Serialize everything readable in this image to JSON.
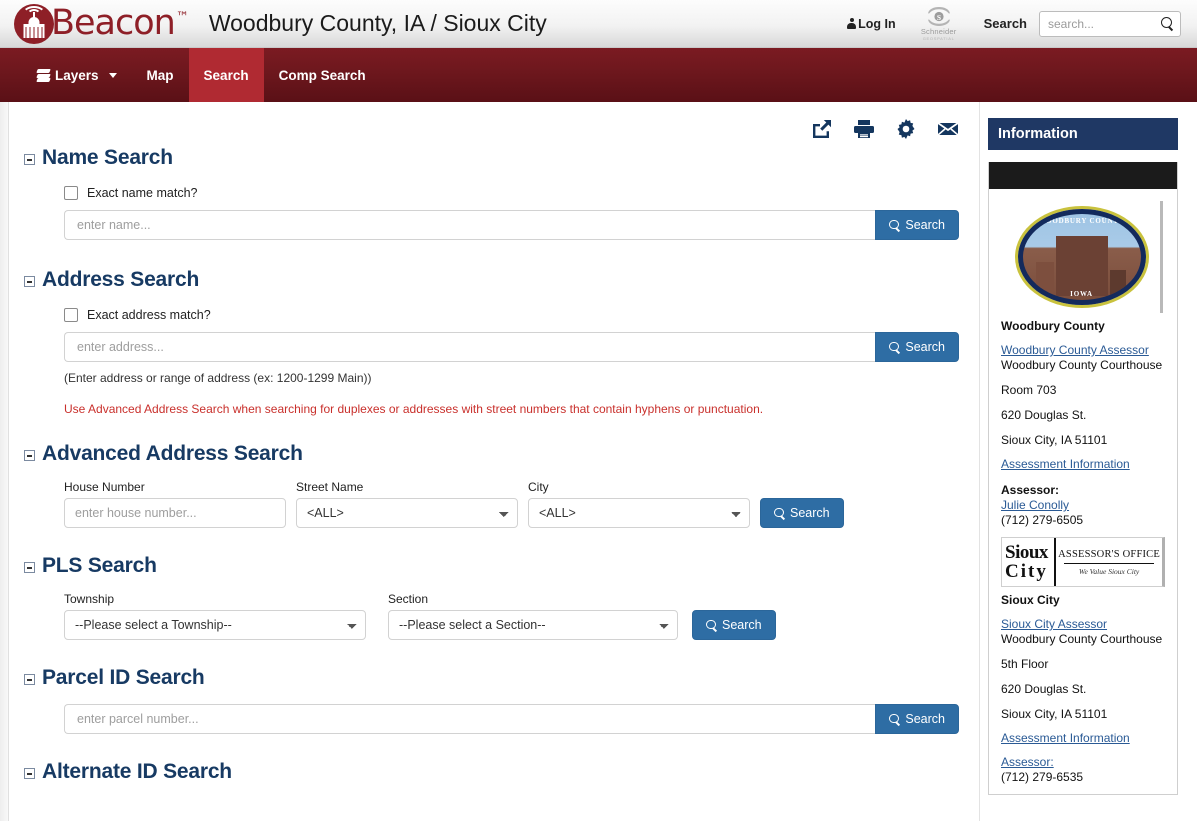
{
  "header": {
    "brand_name": "Beacon",
    "brand_tm": "™",
    "site_title": "Woodbury County, IA / Sioux City",
    "login_label": "Log In",
    "schneider_word": "Schneider",
    "schneider_sub": "GEOSPATIAL",
    "search_word": "Search",
    "search_placeholder": "search...",
    "search_value": ""
  },
  "nav": {
    "layers_label": "Layers",
    "items": [
      {
        "label": "Map",
        "active": false
      },
      {
        "label": "Search",
        "active": true
      },
      {
        "label": "Comp Search",
        "active": false
      }
    ]
  },
  "toolbar": {
    "share_title": "Share",
    "print_title": "Print",
    "settings_title": "Settings",
    "email_title": "Email"
  },
  "sections": {
    "name_search": {
      "title": "Name Search",
      "checkbox_label": "Exact name match?",
      "input_placeholder": "enter name...",
      "input_value": "",
      "button_label": "Search"
    },
    "address_search": {
      "title": "Address Search",
      "checkbox_label": "Exact address match?",
      "input_placeholder": "enter address...",
      "input_value": "",
      "button_label": "Search",
      "hint": "(Enter address or range of address (ex: 1200-1299 Main))",
      "warning": "Use Advanced Address Search when searching for duplexes or addresses with street numbers that contain hyphens or punctuation."
    },
    "advanced_address_search": {
      "title": "Advanced Address Search",
      "house_number_label": "House Number",
      "house_number_placeholder": "enter house number...",
      "house_number_value": "",
      "street_name_label": "Street Name",
      "street_name_value": "<ALL>",
      "city_label": "City",
      "city_value": "<ALL>",
      "button_label": "Search"
    },
    "pls_search": {
      "title": "PLS Search",
      "township_label": "Township",
      "township_value": "--Please select a Township--",
      "section_label": "Section",
      "section_value": "--Please select a Section--",
      "button_label": "Search"
    },
    "parcel_id_search": {
      "title": "Parcel ID Search",
      "input_placeholder": "enter parcel number...",
      "input_value": "",
      "button_label": "Search"
    },
    "alternate_id_search": {
      "title": "Alternate ID Search"
    }
  },
  "sidebar": {
    "panel_title": "Information",
    "county_seal_top": "WOODBURY COUNTY",
    "county_seal_bottom": "IOWA",
    "county_name": "Woodbury County",
    "county_assessor_link": "Woodbury County Assessor",
    "county_courthouse": "Woodbury County Courthouse",
    "county_room": "Room 703",
    "county_street": "620 Douglas St.",
    "county_citystatezip": "Sioux City, IA 51101",
    "county_assessment_link": "Assessment Information",
    "county_assessor_label": "Assessor:",
    "county_assessor_name": "Julie Conolly",
    "county_phone": "(712) 279-6505",
    "sc_logo_city": "Sioux",
    "sc_logo_city2": "City",
    "sc_logo_office": "ASSESSOR'S OFFICE",
    "sc_logo_tagline": "We Value Sioux City",
    "sc_name": "Sioux City",
    "sc_assessor_link": "Sioux City Assessor",
    "sc_courthouse": "Woodbury County Courthouse",
    "sc_floor": "5th Floor",
    "sc_street": "620 Douglas St.",
    "sc_citystatezip": "Sioux City, IA 51101",
    "sc_assessment_link": "Assessment Information",
    "sc_assessor_label": "Assessor:",
    "sc_phone": "(712) 279-6535"
  },
  "colors": {
    "brand_red": "#8e1f27",
    "nav_red": "#6d171d",
    "nav_active": "#b02a32",
    "heading_blue": "#173a63",
    "button_blue": "#2e6da4",
    "panel_header_blue": "#1f3864",
    "warning_red": "#c9302c",
    "link_blue": "#2a5a95"
  }
}
